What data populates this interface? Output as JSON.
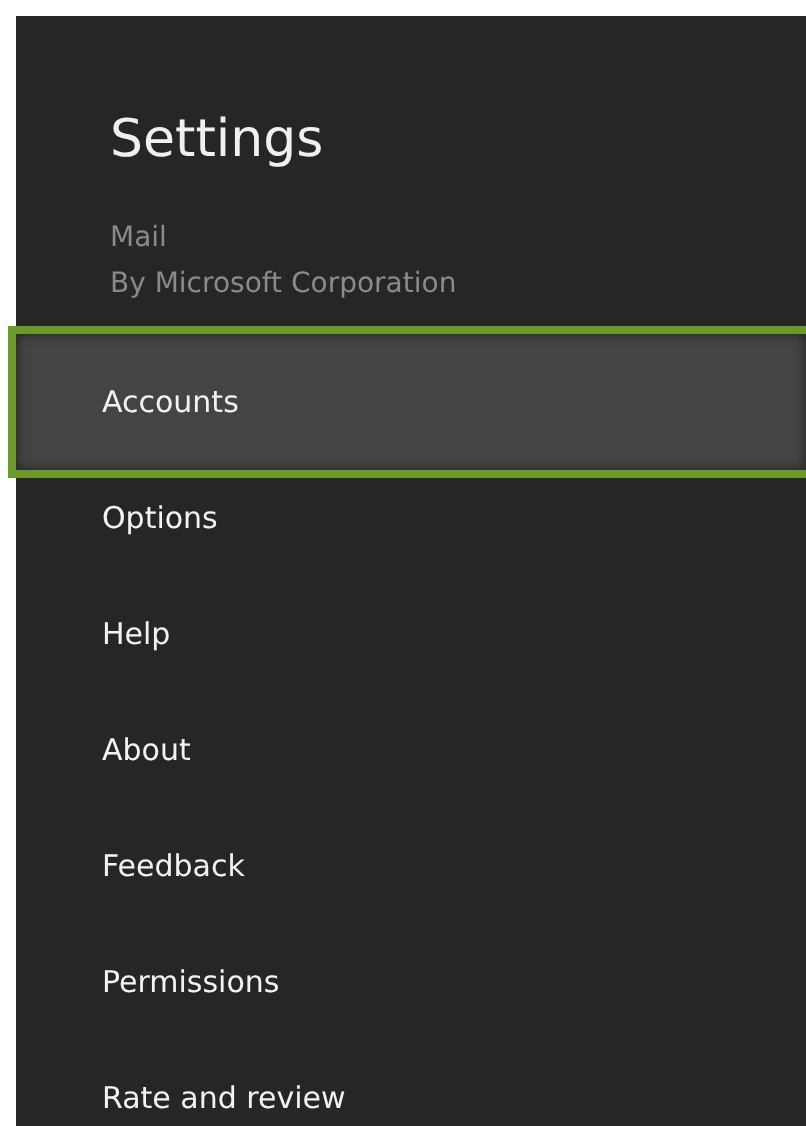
{
  "panel": {
    "title": "Settings",
    "app_name": "Mail",
    "publisher": "By Microsoft Corporation"
  },
  "items": [
    {
      "label": "Accounts",
      "selected": true
    },
    {
      "label": "Options",
      "selected": false
    },
    {
      "label": "Help",
      "selected": false
    },
    {
      "label": "About",
      "selected": false
    },
    {
      "label": "Feedback",
      "selected": false
    },
    {
      "label": "Permissions",
      "selected": false
    },
    {
      "label": "Rate and review",
      "selected": false
    }
  ]
}
